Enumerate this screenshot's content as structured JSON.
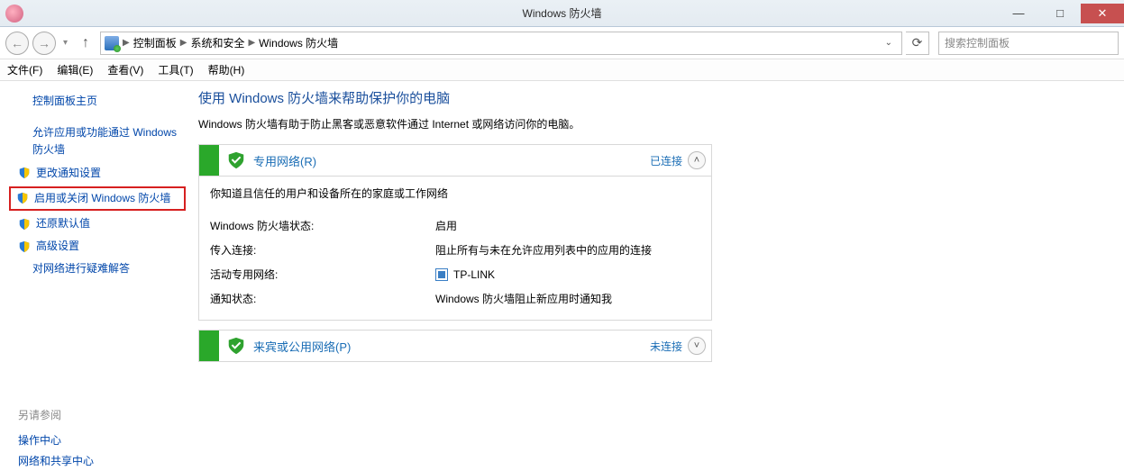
{
  "titlebar": {
    "title": "Windows 防火墙"
  },
  "breadcrumb": {
    "root": "控制面板",
    "mid": "系统和安全",
    "leaf": "Windows 防火墙"
  },
  "search": {
    "placeholder": "搜索控制面板"
  },
  "menu": {
    "file": "文件(F)",
    "edit": "编辑(E)",
    "view": "查看(V)",
    "tools": "工具(T)",
    "help": "帮助(H)"
  },
  "sidebar": {
    "home": "控制面板主页",
    "allow": "允许应用或功能通过 Windows 防火墙",
    "notify": "更改通知设置",
    "toggle": "启用或关闭 Windows 防火墙",
    "restore": "还原默认值",
    "advanced": "高级设置",
    "troubleshoot": "对网络进行疑难解答",
    "seealso_hd": "另请参阅",
    "action_center": "操作中心",
    "net_share": "网络和共享中心"
  },
  "main": {
    "h1": "使用 Windows 防火墙来帮助保护你的电脑",
    "intro": "Windows 防火墙有助于防止黑客或恶意软件通过 Internet 或网络访问你的电脑。",
    "private": {
      "title": "专用网络(R)",
      "status": "已连接",
      "desc": "你知道且信任的用户和设备所在的家庭或工作网络",
      "kv": {
        "state_k": "Windows 防火墙状态:",
        "state_v": "启用",
        "incoming_k": "传入连接:",
        "incoming_v": "阻止所有与未在允许应用列表中的应用的连接",
        "active_k": "活动专用网络:",
        "active_v": "TP-LINK",
        "notify_k": "通知状态:",
        "notify_v": "Windows 防火墙阻止新应用时通知我"
      }
    },
    "public": {
      "title": "来宾或公用网络(P)",
      "status": "未连接"
    }
  }
}
